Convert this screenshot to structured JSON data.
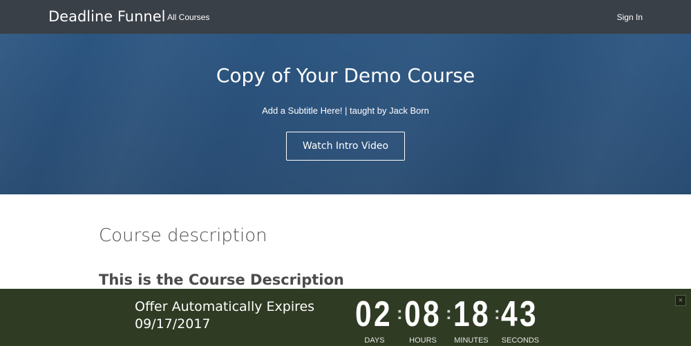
{
  "nav": {
    "brand": "Deadline Funnel",
    "all_courses": "All Courses",
    "sign_in": "Sign In"
  },
  "hero": {
    "title": "Copy of Your Demo Course",
    "subtitle": "Add a Subtitle Here! | taught by Jack Born",
    "intro_button": "Watch Intro Video"
  },
  "content": {
    "section_heading": "Course description",
    "description": "This is the Course Description"
  },
  "countdown": {
    "offer_line1": "Offer Automatically Expires",
    "offer_line2": "09/17/2017",
    "days": "02",
    "hours": "08",
    "minutes": "18",
    "seconds": "43",
    "days_label": "DAYS",
    "hours_label": "HOURS",
    "minutes_label": "MINUTES",
    "seconds_label": "SECONDS",
    "close_symbol": "×"
  },
  "colors": {
    "navbar": "#3a4048",
    "hero": "#2b5580",
    "countdown_bar": "#2f3b23"
  }
}
